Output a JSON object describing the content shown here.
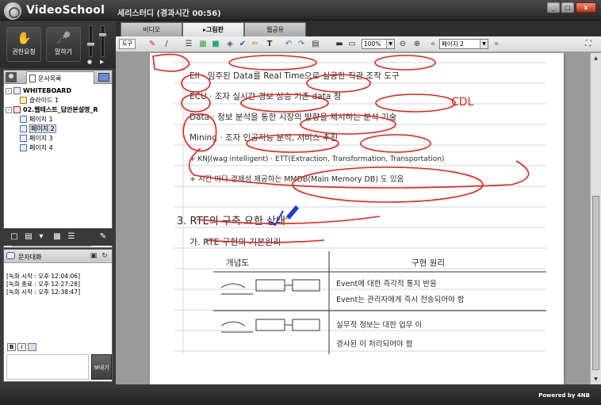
{
  "app": {
    "title": "VideoSchool",
    "session_title": "세리스터디 (경과시간 00:56)",
    "powered_by": "Powered by 4NB"
  },
  "window_controls": {
    "minimize": "_",
    "maximize": "□",
    "close": "x"
  },
  "controls": {
    "request_label": "권한요청",
    "speak_label": "말하기"
  },
  "doc_panel": {
    "tab_label": "문서목록",
    "tree": [
      {
        "label": "WHITEBOARD",
        "level": 0,
        "bold": true
      },
      {
        "label": "슬라이드 1",
        "level": 1
      },
      {
        "label": "02.웹테스트_답안본설명_R",
        "level": 0,
        "bold": true
      },
      {
        "label": "페이지 1",
        "level": 1
      },
      {
        "label": "페이지 2",
        "level": 1,
        "selected": true
      },
      {
        "label": "페이지 3",
        "level": 1
      },
      {
        "label": "페이지 4",
        "level": 1
      }
    ]
  },
  "chat": {
    "title": "문자대화",
    "log": [
      "[녹화 시작 : 오후 12:04:06]",
      "[녹화 종료 : 오후 12:27:28]",
      "[녹화 시작 : 오후 12:38:47]"
    ],
    "send_label": "보내기",
    "format_buttons": [
      "B",
      "I"
    ]
  },
  "main_tabs": [
    {
      "label": "비디오",
      "active": false
    },
    {
      "label": "그림판",
      "active": true
    },
    {
      "label": "웹공유",
      "active": false
    }
  ],
  "toolbar": {
    "tools_label": "도구",
    "zoom": "100%",
    "page_select": "페이지 2"
  },
  "content": {
    "lines": [
      "EII · 임주된 Data를 Real Time으로 실공한 직관 조작 도구",
      "ECU · 조자 실시간 경보 상승 기존 data 정",
      "Data · 정보 분석을 통한 시장의 방향을 제시하는 분석 기술",
      "Mining · 조자 인공지능 분석, 서비스 추진",
      "+ KNJ(wag intelligent) · ETT(Extraction, Transformation, Transportation)",
      "+ 시간 마다 경제성 제공하는 MMDB(Main Memory DB) 도 있음",
      "3. RTE의 구축 요한 상태",
      "가. RTE 구현의 기본원리",
      "개념도",
      "구현 원리",
      "Event에 대한 즉각적 통지 반응",
      "Event는 관리자에게 즉시 전송되어야 함",
      "실무적 정보는 대한 업무 이",
      "경사된 이 처리되어야 함"
    ],
    "annotation": "CDL"
  },
  "colors": {
    "titlebar": "#2f2f2f",
    "ink_red": "#e2231a",
    "ink_blue": "#1e3ccf"
  }
}
